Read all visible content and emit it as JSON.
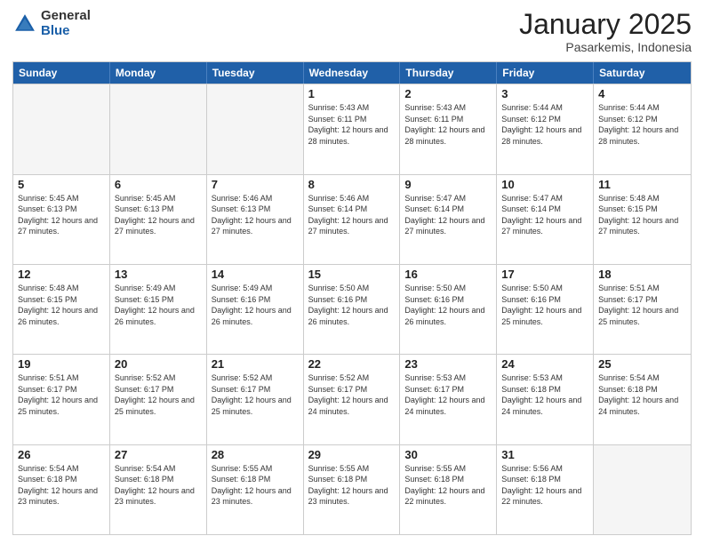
{
  "logo": {
    "general": "General",
    "blue": "Blue"
  },
  "title": "January 2025",
  "location": "Pasarkemis, Indonesia",
  "weekdays": [
    "Sunday",
    "Monday",
    "Tuesday",
    "Wednesday",
    "Thursday",
    "Friday",
    "Saturday"
  ],
  "weeks": [
    [
      {
        "day": "",
        "empty": true
      },
      {
        "day": "",
        "empty": true
      },
      {
        "day": "",
        "empty": true
      },
      {
        "day": "1",
        "sunrise": "5:43 AM",
        "sunset": "6:11 PM",
        "daylight": "12 hours and 28 minutes."
      },
      {
        "day": "2",
        "sunrise": "5:43 AM",
        "sunset": "6:11 PM",
        "daylight": "12 hours and 28 minutes."
      },
      {
        "day": "3",
        "sunrise": "5:44 AM",
        "sunset": "6:12 PM",
        "daylight": "12 hours and 28 minutes."
      },
      {
        "day": "4",
        "sunrise": "5:44 AM",
        "sunset": "6:12 PM",
        "daylight": "12 hours and 28 minutes."
      }
    ],
    [
      {
        "day": "5",
        "sunrise": "5:45 AM",
        "sunset": "6:13 PM",
        "daylight": "12 hours and 27 minutes."
      },
      {
        "day": "6",
        "sunrise": "5:45 AM",
        "sunset": "6:13 PM",
        "daylight": "12 hours and 27 minutes."
      },
      {
        "day": "7",
        "sunrise": "5:46 AM",
        "sunset": "6:13 PM",
        "daylight": "12 hours and 27 minutes."
      },
      {
        "day": "8",
        "sunrise": "5:46 AM",
        "sunset": "6:14 PM",
        "daylight": "12 hours and 27 minutes."
      },
      {
        "day": "9",
        "sunrise": "5:47 AM",
        "sunset": "6:14 PM",
        "daylight": "12 hours and 27 minutes."
      },
      {
        "day": "10",
        "sunrise": "5:47 AM",
        "sunset": "6:14 PM",
        "daylight": "12 hours and 27 minutes."
      },
      {
        "day": "11",
        "sunrise": "5:48 AM",
        "sunset": "6:15 PM",
        "daylight": "12 hours and 27 minutes."
      }
    ],
    [
      {
        "day": "12",
        "sunrise": "5:48 AM",
        "sunset": "6:15 PM",
        "daylight": "12 hours and 26 minutes."
      },
      {
        "day": "13",
        "sunrise": "5:49 AM",
        "sunset": "6:15 PM",
        "daylight": "12 hours and 26 minutes."
      },
      {
        "day": "14",
        "sunrise": "5:49 AM",
        "sunset": "6:16 PM",
        "daylight": "12 hours and 26 minutes."
      },
      {
        "day": "15",
        "sunrise": "5:50 AM",
        "sunset": "6:16 PM",
        "daylight": "12 hours and 26 minutes."
      },
      {
        "day": "16",
        "sunrise": "5:50 AM",
        "sunset": "6:16 PM",
        "daylight": "12 hours and 26 minutes."
      },
      {
        "day": "17",
        "sunrise": "5:50 AM",
        "sunset": "6:16 PM",
        "daylight": "12 hours and 25 minutes."
      },
      {
        "day": "18",
        "sunrise": "5:51 AM",
        "sunset": "6:17 PM",
        "daylight": "12 hours and 25 minutes."
      }
    ],
    [
      {
        "day": "19",
        "sunrise": "5:51 AM",
        "sunset": "6:17 PM",
        "daylight": "12 hours and 25 minutes."
      },
      {
        "day": "20",
        "sunrise": "5:52 AM",
        "sunset": "6:17 PM",
        "daylight": "12 hours and 25 minutes."
      },
      {
        "day": "21",
        "sunrise": "5:52 AM",
        "sunset": "6:17 PM",
        "daylight": "12 hours and 25 minutes."
      },
      {
        "day": "22",
        "sunrise": "5:52 AM",
        "sunset": "6:17 PM",
        "daylight": "12 hours and 24 minutes."
      },
      {
        "day": "23",
        "sunrise": "5:53 AM",
        "sunset": "6:17 PM",
        "daylight": "12 hours and 24 minutes."
      },
      {
        "day": "24",
        "sunrise": "5:53 AM",
        "sunset": "6:18 PM",
        "daylight": "12 hours and 24 minutes."
      },
      {
        "day": "25",
        "sunrise": "5:54 AM",
        "sunset": "6:18 PM",
        "daylight": "12 hours and 24 minutes."
      }
    ],
    [
      {
        "day": "26",
        "sunrise": "5:54 AM",
        "sunset": "6:18 PM",
        "daylight": "12 hours and 23 minutes."
      },
      {
        "day": "27",
        "sunrise": "5:54 AM",
        "sunset": "6:18 PM",
        "daylight": "12 hours and 23 minutes."
      },
      {
        "day": "28",
        "sunrise": "5:55 AM",
        "sunset": "6:18 PM",
        "daylight": "12 hours and 23 minutes."
      },
      {
        "day": "29",
        "sunrise": "5:55 AM",
        "sunset": "6:18 PM",
        "daylight": "12 hours and 23 minutes."
      },
      {
        "day": "30",
        "sunrise": "5:55 AM",
        "sunset": "6:18 PM",
        "daylight": "12 hours and 22 minutes."
      },
      {
        "day": "31",
        "sunrise": "5:56 AM",
        "sunset": "6:18 PM",
        "daylight": "12 hours and 22 minutes."
      },
      {
        "day": "",
        "empty": true
      }
    ]
  ]
}
